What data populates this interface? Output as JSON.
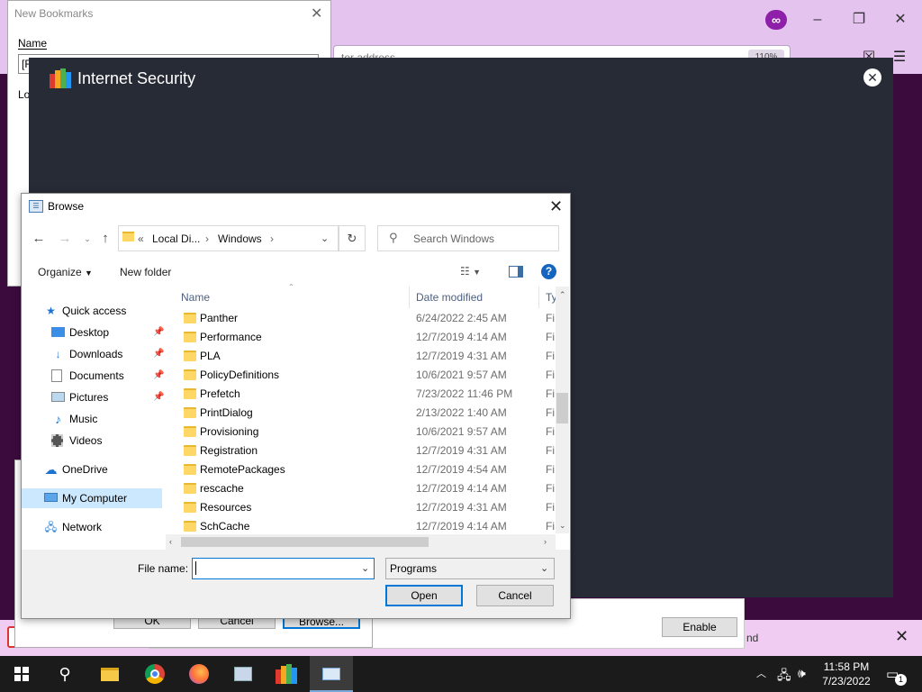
{
  "firefox": {
    "url_partial": "ter address",
    "zoom": "110%"
  },
  "new_bookmarks": {
    "title": "New Bookmarks",
    "name_label": "Name",
    "name_value": "[F",
    "location_label_partial": "Lo",
    "ok_label": "OK",
    "cancel_label": "Cancel",
    "browse_label": "Browse..."
  },
  "notification": {
    "enable_label": "Enable",
    "text_partial": "nd"
  },
  "avg": {
    "title": "Internet Security"
  },
  "browse": {
    "title": "Browse",
    "path": {
      "prefix": "«",
      "segments": [
        "Local Di...",
        "Windows"
      ]
    },
    "search_placeholder": "Search Windows",
    "toolbar": {
      "organize_label": "Organize",
      "new_folder_label": "New folder"
    },
    "nav": [
      {
        "label": "Quick access",
        "icon": "star-icon",
        "pinned": false
      },
      {
        "label": "Desktop",
        "icon": "desktop-icon",
        "pinned": true
      },
      {
        "label": "Downloads",
        "icon": "download-icon",
        "pinned": true
      },
      {
        "label": "Documents",
        "icon": "documents-icon",
        "pinned": true
      },
      {
        "label": "Pictures",
        "icon": "pictures-icon",
        "pinned": true
      },
      {
        "label": "Music",
        "icon": "music-icon",
        "pinned": false
      },
      {
        "label": "Videos",
        "icon": "videos-icon",
        "pinned": false
      },
      {
        "label": "OneDrive",
        "icon": "cloud-icon",
        "pinned": false
      },
      {
        "label": "My Computer",
        "icon": "computer-icon",
        "pinned": false
      },
      {
        "label": "Network",
        "icon": "network-icon",
        "pinned": false
      }
    ],
    "columns": {
      "name": "Name",
      "date": "Date modified",
      "type": "Ty"
    },
    "files": [
      {
        "name": "Panther",
        "date": "6/24/2022 2:45 AM",
        "type": "Fi"
      },
      {
        "name": "Performance",
        "date": "12/7/2019 4:14 AM",
        "type": "Fi"
      },
      {
        "name": "PLA",
        "date": "12/7/2019 4:31 AM",
        "type": "Fi"
      },
      {
        "name": "PolicyDefinitions",
        "date": "10/6/2021 9:57 AM",
        "type": "Fi"
      },
      {
        "name": "Prefetch",
        "date": "7/23/2022 11:46 PM",
        "type": "Fi"
      },
      {
        "name": "PrintDialog",
        "date": "2/13/2022 1:40 AM",
        "type": "Fi"
      },
      {
        "name": "Provisioning",
        "date": "10/6/2021 9:57 AM",
        "type": "Fi"
      },
      {
        "name": "Registration",
        "date": "12/7/2019 4:31 AM",
        "type": "Fi"
      },
      {
        "name": "RemotePackages",
        "date": "12/7/2019 4:54 AM",
        "type": "Fi"
      },
      {
        "name": "rescache",
        "date": "12/7/2019 4:14 AM",
        "type": "Fi"
      },
      {
        "name": "Resources",
        "date": "12/7/2019 4:31 AM",
        "type": "Fi"
      },
      {
        "name": "SchCache",
        "date": "12/7/2019 4:14 AM",
        "type": "Fi"
      }
    ],
    "file_name_label": "File name:",
    "file_name_value": "",
    "file_type_value": "Programs",
    "open_label": "Open",
    "cancel_label": "Cancel"
  },
  "taskbar": {
    "time": "11:58 PM",
    "date": "7/23/2022",
    "notification_count": "1"
  }
}
